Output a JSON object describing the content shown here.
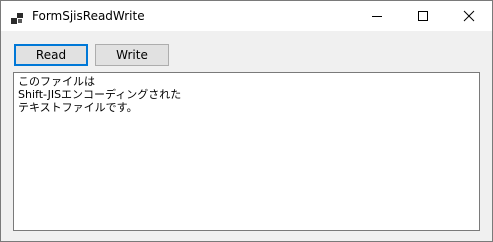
{
  "window": {
    "title": "FormSjisReadWrite",
    "app_icon": "winforms-app-icon",
    "controls": {
      "minimize_icon": "minimize-icon",
      "maximize_icon": "maximize-icon",
      "close_icon": "close-icon"
    }
  },
  "buttons": {
    "read_label": "Read",
    "write_label": "Write"
  },
  "textbox": {
    "lines": [
      "このファイルは",
      "Shift-JISエンコーディングされた",
      "テキストファイルです。"
    ]
  },
  "colors": {
    "focus_border": "#0078d7",
    "button_face": "#e1e1e1",
    "window_background": "#f0f0f0"
  }
}
